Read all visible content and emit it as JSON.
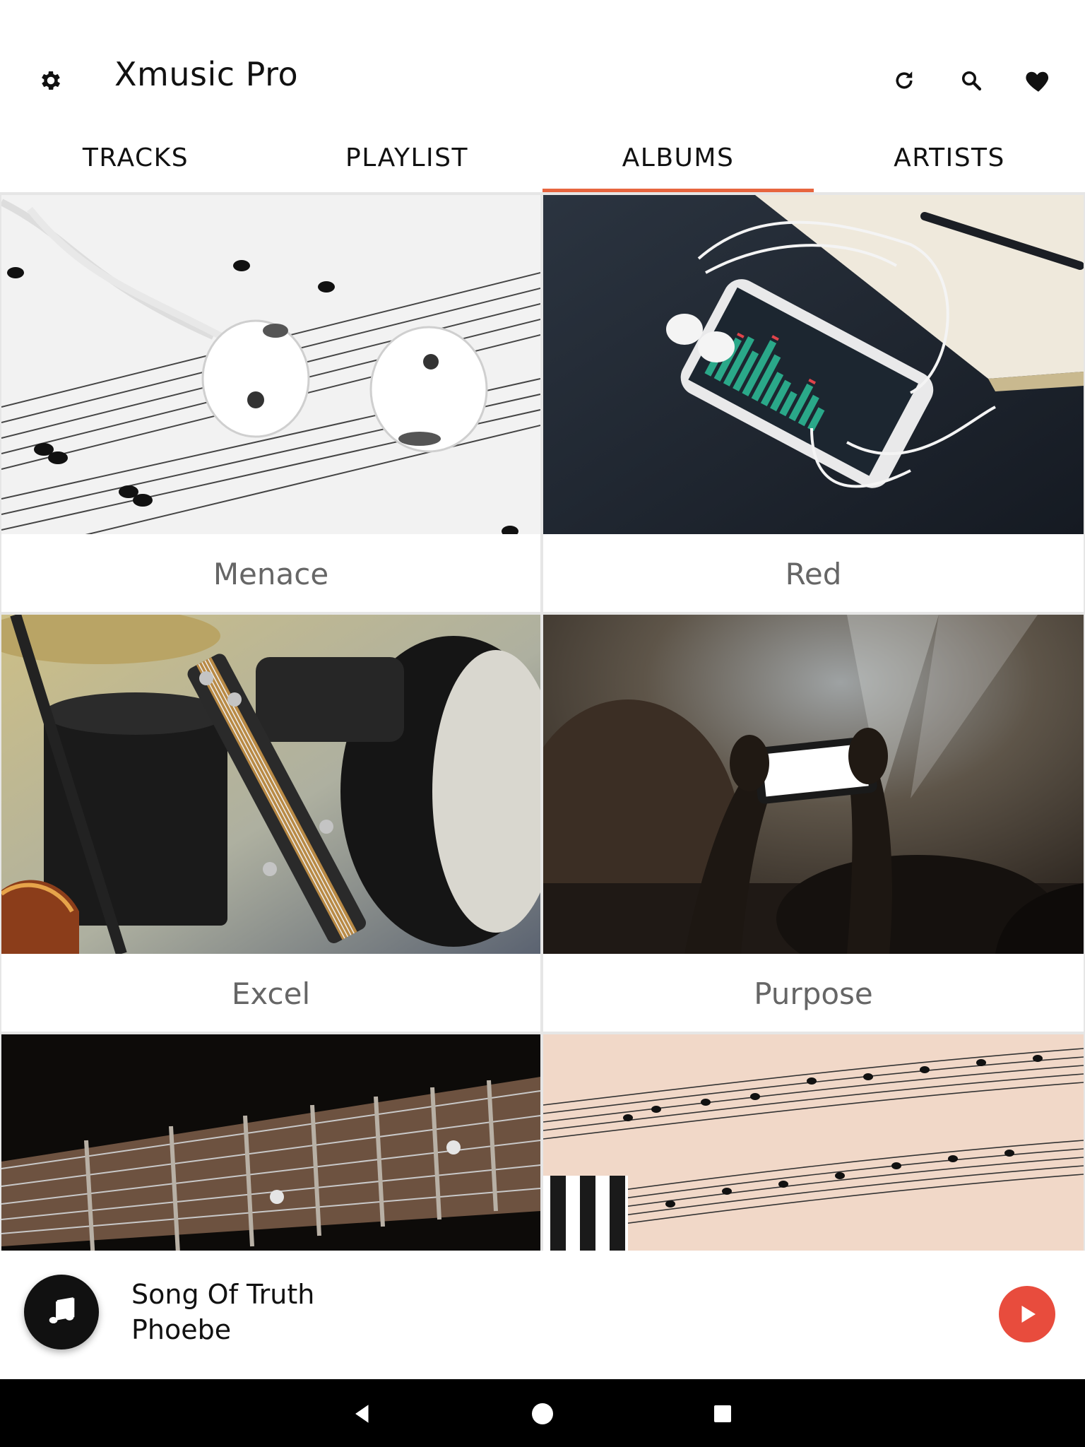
{
  "app": {
    "title": "Xmusic Pro"
  },
  "toolbar": {
    "settings_icon": "gear-icon",
    "refresh_icon": "refresh-icon",
    "search_icon": "search-icon",
    "favorites_icon": "heart-icon"
  },
  "tabs": [
    {
      "label": "TRACKS",
      "active": false
    },
    {
      "label": "PLAYLIST",
      "active": false
    },
    {
      "label": "ALBUMS",
      "active": true
    },
    {
      "label": "ARTISTS",
      "active": false
    }
  ],
  "colors": {
    "accent": "#e7653f",
    "play_button": "#e84c3d",
    "label_text": "#666666",
    "nav_bar": "#000000"
  },
  "albums": [
    {
      "name": "Menace"
    },
    {
      "name": "Red"
    },
    {
      "name": "Excel"
    },
    {
      "name": "Purpose"
    },
    {
      "name": ""
    },
    {
      "name": ""
    }
  ],
  "now_playing": {
    "title": "Song Of Truth",
    "artist": "Phoebe",
    "art_icon": "music-note-icon",
    "play_icon": "play-icon"
  },
  "system_nav": {
    "back_icon": "back-icon",
    "home_icon": "home-icon",
    "recents_icon": "recents-icon"
  }
}
